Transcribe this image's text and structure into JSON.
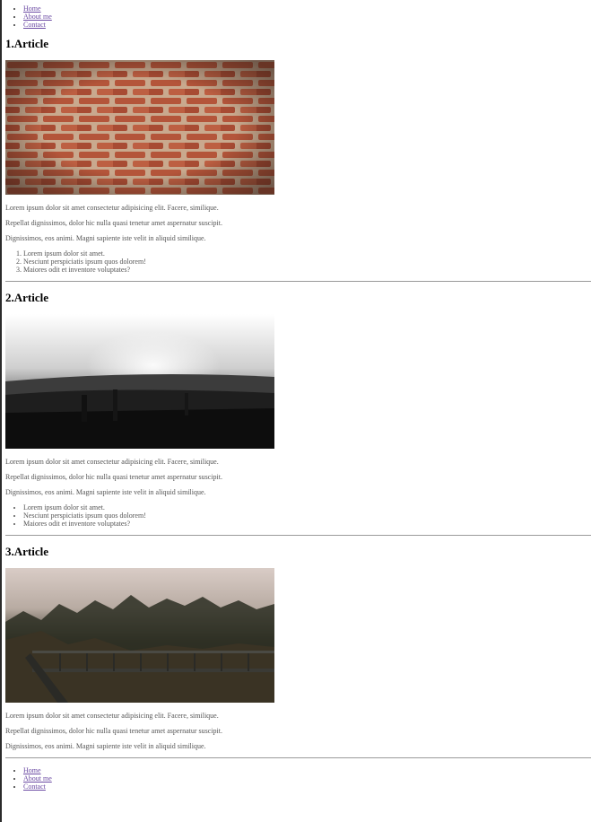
{
  "nav": {
    "items": [
      {
        "label": "Home"
      },
      {
        "label": "About me"
      },
      {
        "label": "Contact"
      }
    ]
  },
  "articles": [
    {
      "title": "1.Article",
      "paragraphs": [
        "Lorem ipsum dolor sit amet consectetur adipisicing elit. Facere, similique.",
        "Repellat dignissimos, dolor hic nulla quasi tenetur amet aspernatur suscipit.",
        "Dignissimos, eos animi. Magni sapiente iste velit in aliquid similique."
      ],
      "list_type": "ordered",
      "list": [
        "Lorem ipsum dolor sit amet.",
        "Nesciunt perspiciatis ipsum quos dolorem!",
        "Maiores odit et inventore voluptates?"
      ]
    },
    {
      "title": "2.Article",
      "paragraphs": [
        "Lorem ipsum dolor sit amet consectetur adipisicing elit. Facere, similique.",
        "Repellat dignissimos, dolor hic nulla quasi tenetur amet aspernatur suscipit.",
        "Dignissimos, eos animi. Magni sapiente iste velit in aliquid similique."
      ],
      "list_type": "unordered",
      "list": [
        "Lorem ipsum dolor sit amet.",
        "Nesciunt perspiciatis ipsum quos dolorem!",
        "Maiores odit et inventore voluptates?"
      ]
    },
    {
      "title": "3.Article",
      "paragraphs": [
        "Lorem ipsum dolor sit amet consectetur adipisicing elit. Facere, similique.",
        "Repellat dignissimos, dolor hic nulla quasi tenetur amet aspernatur suscipit.",
        "Dignissimos, eos animi. Magni sapiente iste velit in aliquid similique."
      ]
    }
  ],
  "colors": {
    "link": "#6b4aa3",
    "body_text": "#555555",
    "divider": "#9a9a9a"
  }
}
